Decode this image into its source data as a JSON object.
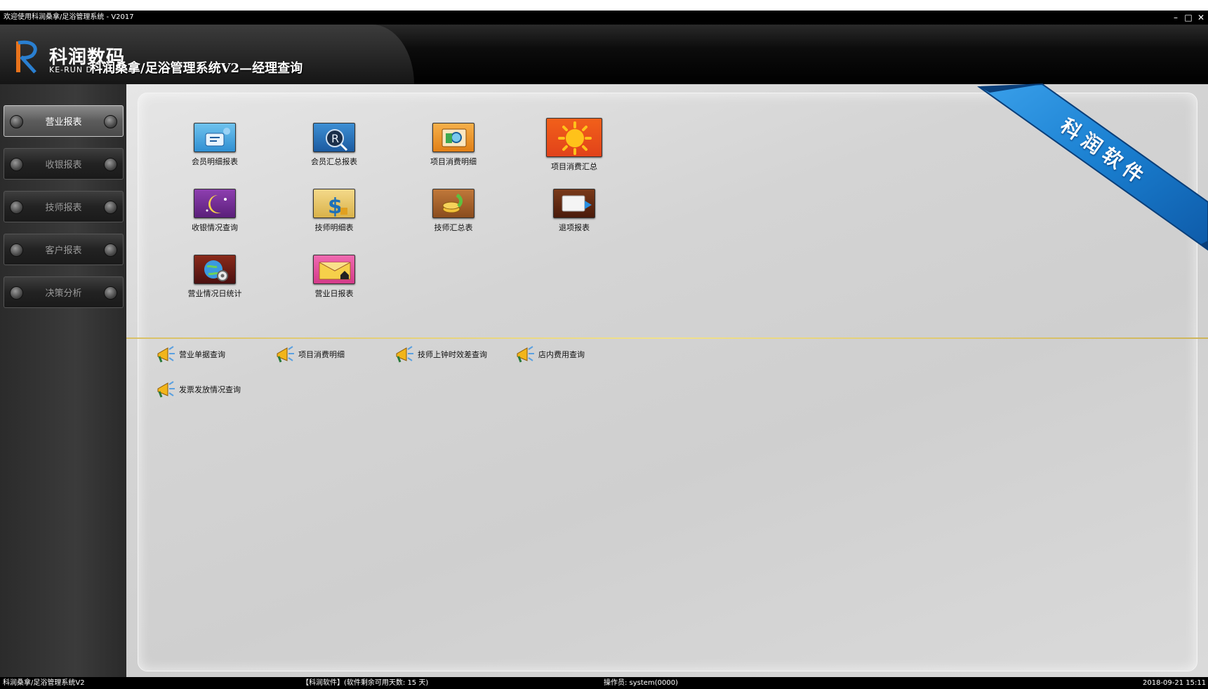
{
  "window": {
    "title": "欢迎使用科润桑拿/足浴管理系统 - V2017",
    "controls": [
      "–",
      "□",
      "✕"
    ]
  },
  "header": {
    "logo_cn": "科润数码",
    "logo_en": "KE-RUN D",
    "app_title": "科润桑拿/足浴管理系统V2—经理查询"
  },
  "sidebar": {
    "items": [
      {
        "label": "营业报表",
        "active": true
      },
      {
        "label": "收银报表",
        "active": false
      },
      {
        "label": "技师报表",
        "active": false
      },
      {
        "label": "客户报表",
        "active": false
      },
      {
        "label": "决策分析",
        "active": false
      }
    ]
  },
  "reports": [
    {
      "label": "会员明细报表",
      "icon": "member-detail-icon"
    },
    {
      "label": "会员汇总报表",
      "icon": "member-summary-icon"
    },
    {
      "label": "项目消费明细",
      "icon": "item-detail-icon"
    },
    {
      "label": "项目消费汇总",
      "icon": "sun-icon"
    },
    {
      "label": "收银情况查询",
      "icon": "moon-icon"
    },
    {
      "label": "技师明细表",
      "icon": "dollar-icon"
    },
    {
      "label": "技师汇总表",
      "icon": "coins-icon"
    },
    {
      "label": "退项报表",
      "icon": "return-icon"
    },
    {
      "label": "营业情况日统计",
      "icon": "globe-gear-icon"
    },
    {
      "label": "营业日报表",
      "icon": "home-icon"
    }
  ],
  "queries": [
    {
      "label": "营业单据查询"
    },
    {
      "label": "项目消费明细"
    },
    {
      "label": "技师上钟时效差查询"
    },
    {
      "label": "店内费用查询"
    },
    {
      "label": "发票发放情况查询"
    }
  ],
  "ribbon": {
    "text": "科润软件"
  },
  "status": {
    "app": "科润桑拿/足浴管理系统V2",
    "license": "【科润软件】(软件剩余可用天数: 15 天)",
    "operator": "操作员: system(0000)",
    "datetime": "2018-09-21 15:11"
  },
  "colors": {
    "accent_blue": "#1a7fd0",
    "divider_gold": "#e8d37a",
    "active_nav": "#6a6a6a"
  }
}
